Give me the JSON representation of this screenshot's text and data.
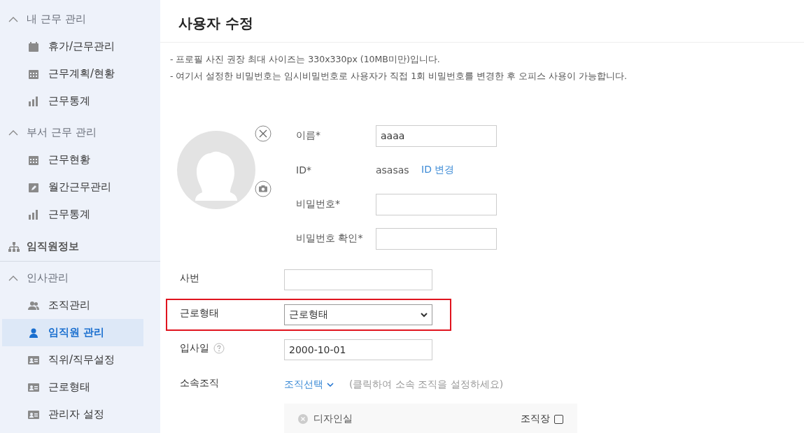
{
  "sidebar": {
    "items": [
      {
        "kind": "group",
        "label": "내 근무 관리",
        "expanded": true,
        "children": [
          {
            "label": "휴가/근무관리",
            "selected": false
          },
          {
            "label": "근무계획/현황",
            "selected": false
          },
          {
            "label": "근무통계",
            "selected": false
          }
        ]
      },
      {
        "kind": "group",
        "label": "부서 근무 관리",
        "expanded": true,
        "children": [
          {
            "label": "근무현황",
            "selected": false
          },
          {
            "label": "월간근무관리",
            "selected": false
          },
          {
            "label": "근무통계",
            "selected": false
          }
        ]
      },
      {
        "kind": "link",
        "label": "임직원정보",
        "selected": false
      },
      {
        "kind": "group",
        "label": "인사관리",
        "expanded": true,
        "children": [
          {
            "label": "조직관리",
            "selected": false
          },
          {
            "label": "임직원 관리",
            "selected": true
          },
          {
            "label": "직위/직무설정",
            "selected": false
          },
          {
            "label": "근로형태",
            "selected": false
          },
          {
            "label": "관리자 설정",
            "selected": false
          }
        ]
      }
    ]
  },
  "page": {
    "title": "사용자 수정",
    "notes": [
      "- 프로필 사진 권장 최대 사이즈는 330x330px (10MB미만)입니다.",
      "- 여기서 설정한 비밀번호는 임시비밀번호로 사용자가 직접 1회 비밀번호를 변경한 후 오피스 사용이 가능합니다."
    ]
  },
  "profile_fields": [
    {
      "kind": "input",
      "label": "이름*",
      "value": "aaaa"
    },
    {
      "kind": "text",
      "label": "ID*",
      "value": "asasas",
      "link": "ID 변경"
    },
    {
      "kind": "input",
      "label": "비밀번호*"
    },
    {
      "kind": "input",
      "label": "비밀번호 확인*"
    }
  ],
  "fields": [
    {
      "kind": "input",
      "label": "사번",
      "highlighted": false
    },
    {
      "kind": "select",
      "label": "근로형태",
      "value": "근로형태",
      "highlighted": true
    },
    {
      "kind": "input",
      "label": "입사일",
      "value": "2000-10-01",
      "help": true,
      "highlighted": false
    },
    {
      "kind": "org",
      "label": "소속조직",
      "link": "조직선택",
      "hint": "(클릭하여 소속 조직을 설정하세요)",
      "highlighted": false,
      "orgs": [
        {
          "name": "디자인실",
          "leader_label": "조직장",
          "leader_checked": false
        }
      ]
    }
  ]
}
